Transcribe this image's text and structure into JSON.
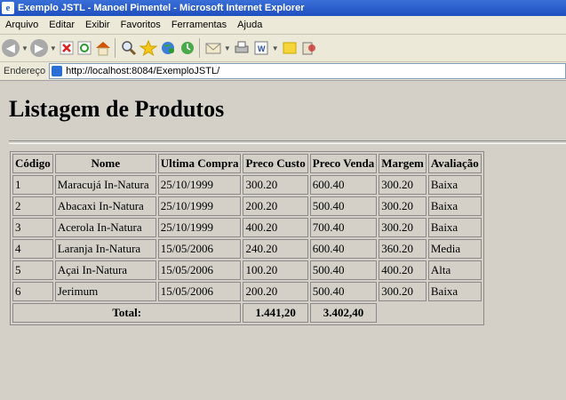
{
  "window": {
    "title": "Exemplo JSTL - Manoel Pimentel - Microsoft Internet Explorer"
  },
  "menu": [
    "Arquivo",
    "Editar",
    "Exibir",
    "Favoritos",
    "Ferramentas",
    "Ajuda"
  ],
  "address": {
    "label": "Endereço",
    "url": "http://localhost:8084/ExemploJSTL/"
  },
  "page": {
    "heading": "Listagem de Produtos"
  },
  "table": {
    "headers": [
      "Código",
      "Nome",
      "Ultima Compra",
      "Preco Custo",
      "Preco Venda",
      "Margem",
      "Avaliação"
    ],
    "rows": [
      [
        "1",
        "Maracujá In-Natura",
        "25/10/1999",
        "300.20",
        "600.40",
        "300.20",
        "Baixa"
      ],
      [
        "2",
        "Abacaxi In-Natura",
        "25/10/1999",
        "200.20",
        "500.40",
        "300.20",
        "Baixa"
      ],
      [
        "3",
        "Acerola In-Natura",
        "25/10/1999",
        "400.20",
        "700.40",
        "300.20",
        "Baixa"
      ],
      [
        "4",
        "Laranja In-Natura",
        "15/05/2006",
        "240.20",
        "600.40",
        "360.20",
        "Media"
      ],
      [
        "5",
        "Açai In-Natura",
        "15/05/2006",
        "100.20",
        "500.40",
        "400.20",
        "Alta"
      ],
      [
        "6",
        "Jerimum",
        "15/05/2006",
        "200.20",
        "500.40",
        "300.20",
        "Baixa"
      ]
    ],
    "total": {
      "label": "Total:",
      "custo": "1.441,20",
      "venda": "3.402,40"
    }
  }
}
